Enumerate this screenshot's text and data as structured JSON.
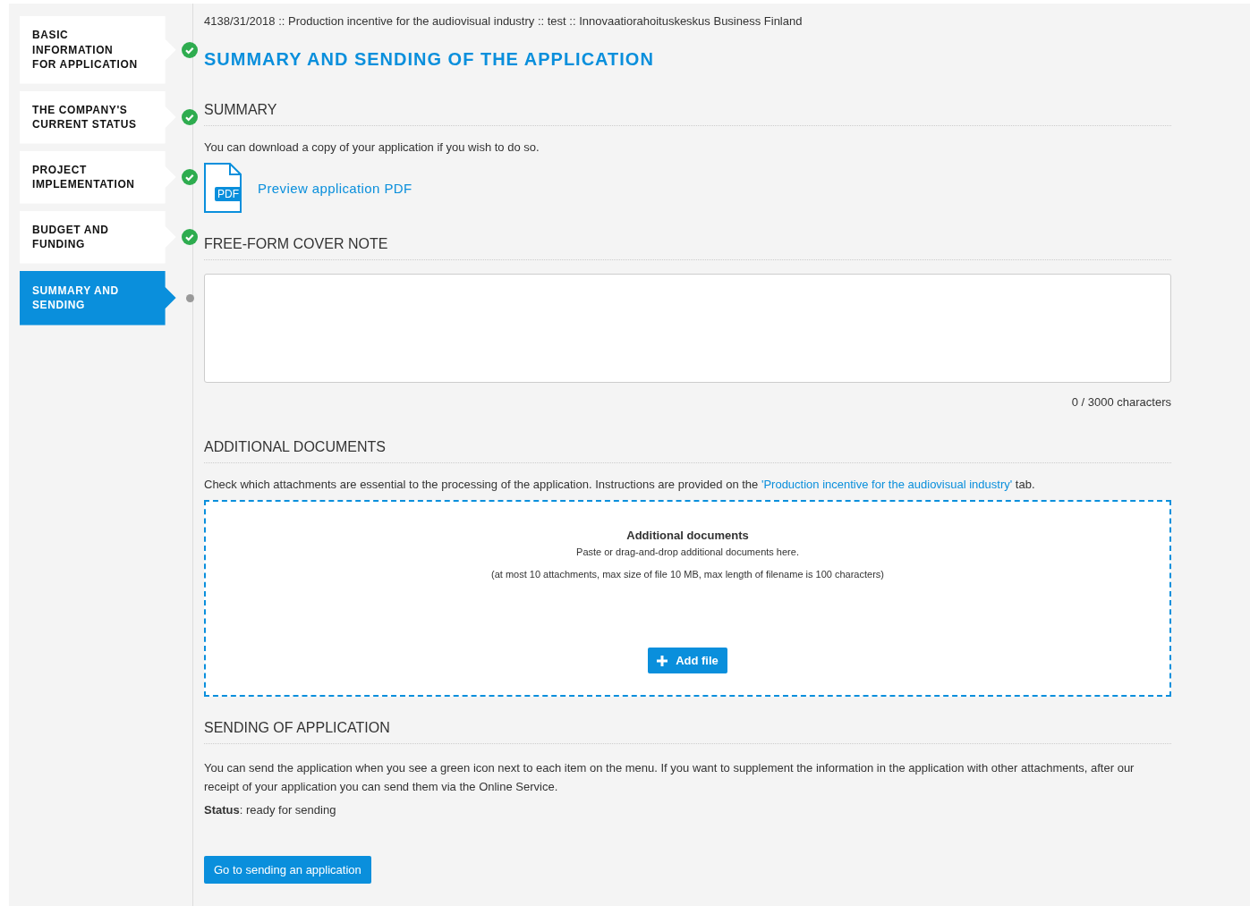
{
  "steps": [
    {
      "label": "BASIC\nINFORMATION\nFOR APPLICATION",
      "selected": false,
      "complete": true
    },
    {
      "label": "THE COMPANY'S\nCURRENT STATUS",
      "selected": false,
      "complete": true
    },
    {
      "label": "PROJECT\nIMPLEMENTATION",
      "selected": false,
      "complete": true
    },
    {
      "label": "BUDGET AND\nFUNDING",
      "selected": false,
      "complete": true
    },
    {
      "label": "SUMMARY AND\nSENDING",
      "selected": true,
      "complete": false
    }
  ],
  "breadcrumb": "4138/31/2018 :: Production incentive for the audiovisual industry :: test :: Innovaatiorahoituskeskus Business Finland",
  "title": "SUMMARY AND SENDING OF THE APPLICATION",
  "summary": {
    "heading": "SUMMARY",
    "text": "You can download a copy of your application if you wish to do so.",
    "pdf_badge": "PDF",
    "pdf_link": "Preview application PDF"
  },
  "cover_note": {
    "heading": "FREE-FORM COVER NOTE",
    "counter": "0 / 3000 characters"
  },
  "additional": {
    "heading": "ADDITIONAL DOCUMENTS",
    "text_before": "Check which attachments are essential to the processing of the application. Instructions are provided on the ",
    "link": "'Production incentive for the audiovisual industry'",
    "text_after": " tab.",
    "drop_title": "Additional documents",
    "drop_hint": "Paste or drag-and-drop additional documents here.",
    "drop_limits": "(at most 10 attachments, max size of file 10 MB, max length of filename is 100 characters)",
    "add_button": "Add file"
  },
  "sending": {
    "heading": "SENDING OF APPLICATION",
    "text": "You can send the application when you see a green icon next to each item on the menu. If you want to supplement the information in the application with other attachments, after our receipt of your application you can send them via the Online Service.",
    "status": "**Status**: ready for sending",
    "button": "Go to sending an application"
  }
}
